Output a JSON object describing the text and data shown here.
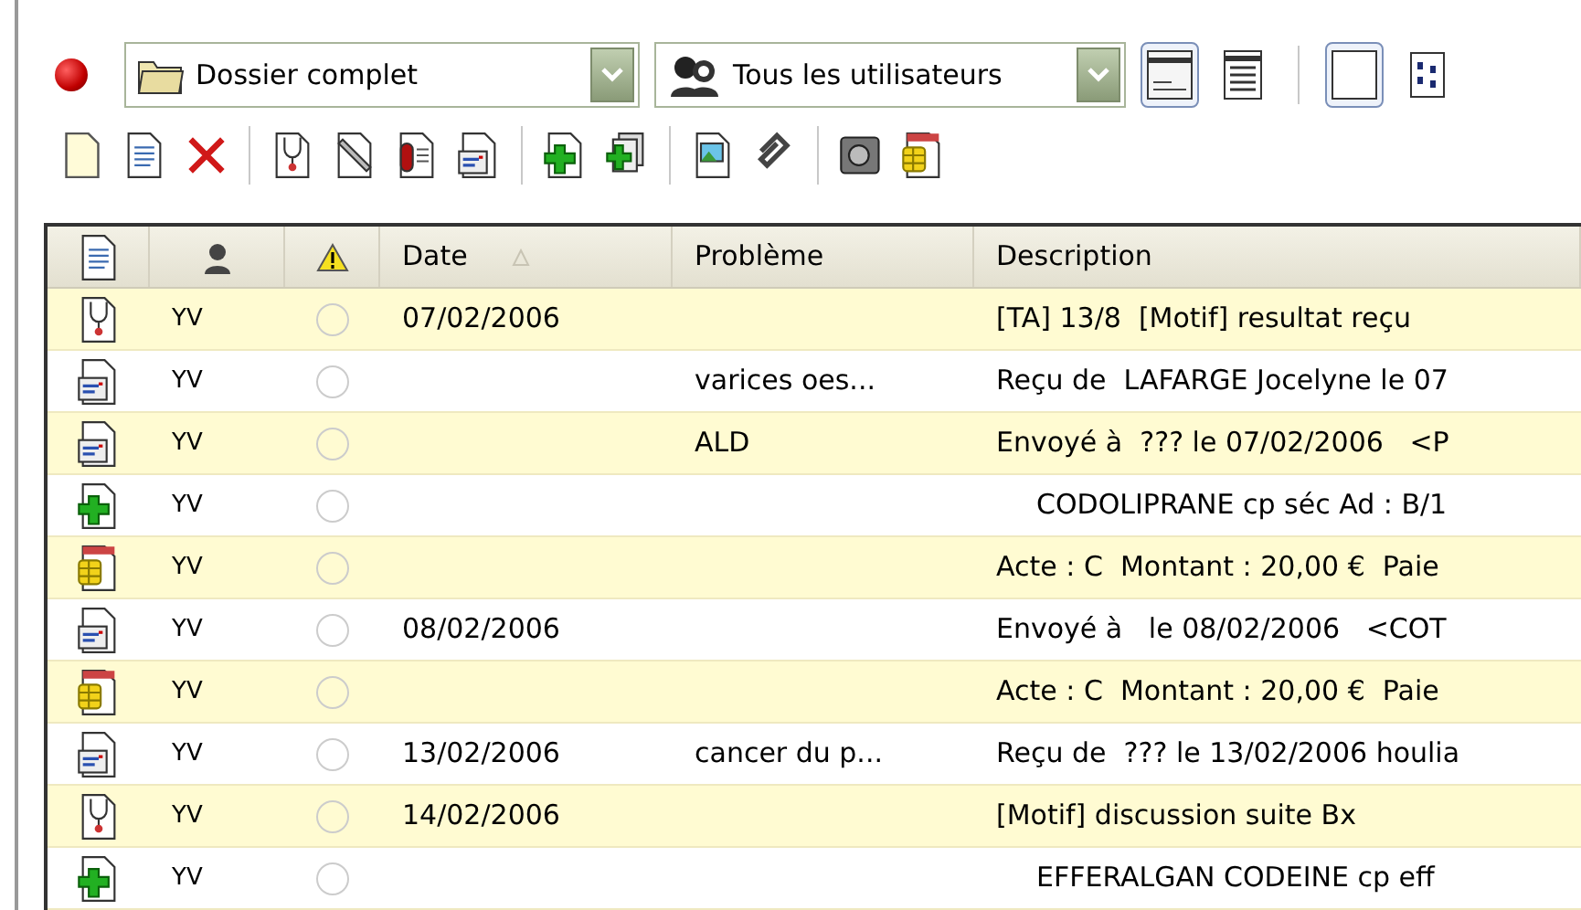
{
  "toolbar": {
    "indicator": {
      "on": true
    },
    "combos": [
      {
        "kind": "folder",
        "value": "Dossier complet"
      },
      {
        "kind": "users",
        "value": "Tous les utilisateurs"
      }
    ],
    "view_groups": [
      [
        {
          "kind": "window",
          "selected": true
        },
        {
          "kind": "list",
          "selected": false
        }
      ],
      [
        {
          "kind": "blank",
          "selected": true
        },
        {
          "kind": "columns",
          "selected": false
        }
      ]
    ],
    "button_groups": [
      [
        {
          "kind": "new"
        },
        {
          "kind": "text"
        },
        {
          "kind": "delete"
        }
      ],
      [
        {
          "kind": "consultation"
        },
        {
          "kind": "pen"
        },
        {
          "kind": "lab"
        },
        {
          "kind": "letter"
        }
      ],
      [
        {
          "kind": "prescription"
        },
        {
          "kind": "multi"
        }
      ],
      [
        {
          "kind": "image"
        },
        {
          "kind": "clip"
        }
      ],
      [
        {
          "kind": "safe"
        },
        {
          "kind": "billing"
        }
      ]
    ]
  },
  "table": {
    "columns": [
      {
        "kind": "icon",
        "sorted": false
      },
      {
        "kind": "icon",
        "sorted": false
      },
      {
        "kind": "icon",
        "sorted": false
      },
      {
        "kind": "text",
        "label": "Date",
        "sorted": true
      },
      {
        "kind": "text",
        "label": "Problème",
        "sorted": false
      },
      {
        "kind": "text",
        "label": "Description",
        "sorted": false
      }
    ],
    "rows": [
      {
        "kind": "consultation",
        "user": "YV",
        "alert": false,
        "date": "07/02/2006",
        "description": "[TA] 13/8  [Motif] resultat reçu"
      },
      {
        "kind": "letter",
        "user": "YV",
        "alert": false,
        "problem": "varices oes...",
        "description": "Reçu de  LAFARGE Jocelyne le 07"
      },
      {
        "kind": "letter",
        "user": "YV",
        "alert": false,
        "problem": "ALD",
        "description": "Envoyé à  ??? le 07/02/2006   <P"
      },
      {
        "kind": "prescription",
        "user": "YV",
        "alert": false,
        "description": "CODOLIPRANE cp séc Ad : B/1"
      },
      {
        "kind": "billing",
        "user": "YV",
        "alert": false,
        "description": "Acte : C  Montant : 20,00 €  Paie"
      },
      {
        "kind": "letter",
        "user": "YV",
        "alert": false,
        "date": "08/02/2006",
        "description": "Envoyé à   le 08/02/2006   <COT"
      },
      {
        "kind": "billing",
        "user": "YV",
        "alert": false,
        "description": "Acte : C  Montant : 20,00 €  Paie"
      },
      {
        "kind": "letter",
        "user": "YV",
        "alert": false,
        "date": "13/02/2006",
        "problem": "cancer du p...",
        "description": "Reçu de  ??? le 13/02/2006 houlia"
      },
      {
        "kind": "consultation",
        "user": "YV",
        "alert": false,
        "date": "14/02/2006",
        "description": "[Motif] discussion suite Bx"
      },
      {
        "kind": "prescription",
        "user": "YV",
        "alert": false,
        "description": "EFFERALGAN CODEINE cp eff"
      }
    ]
  }
}
